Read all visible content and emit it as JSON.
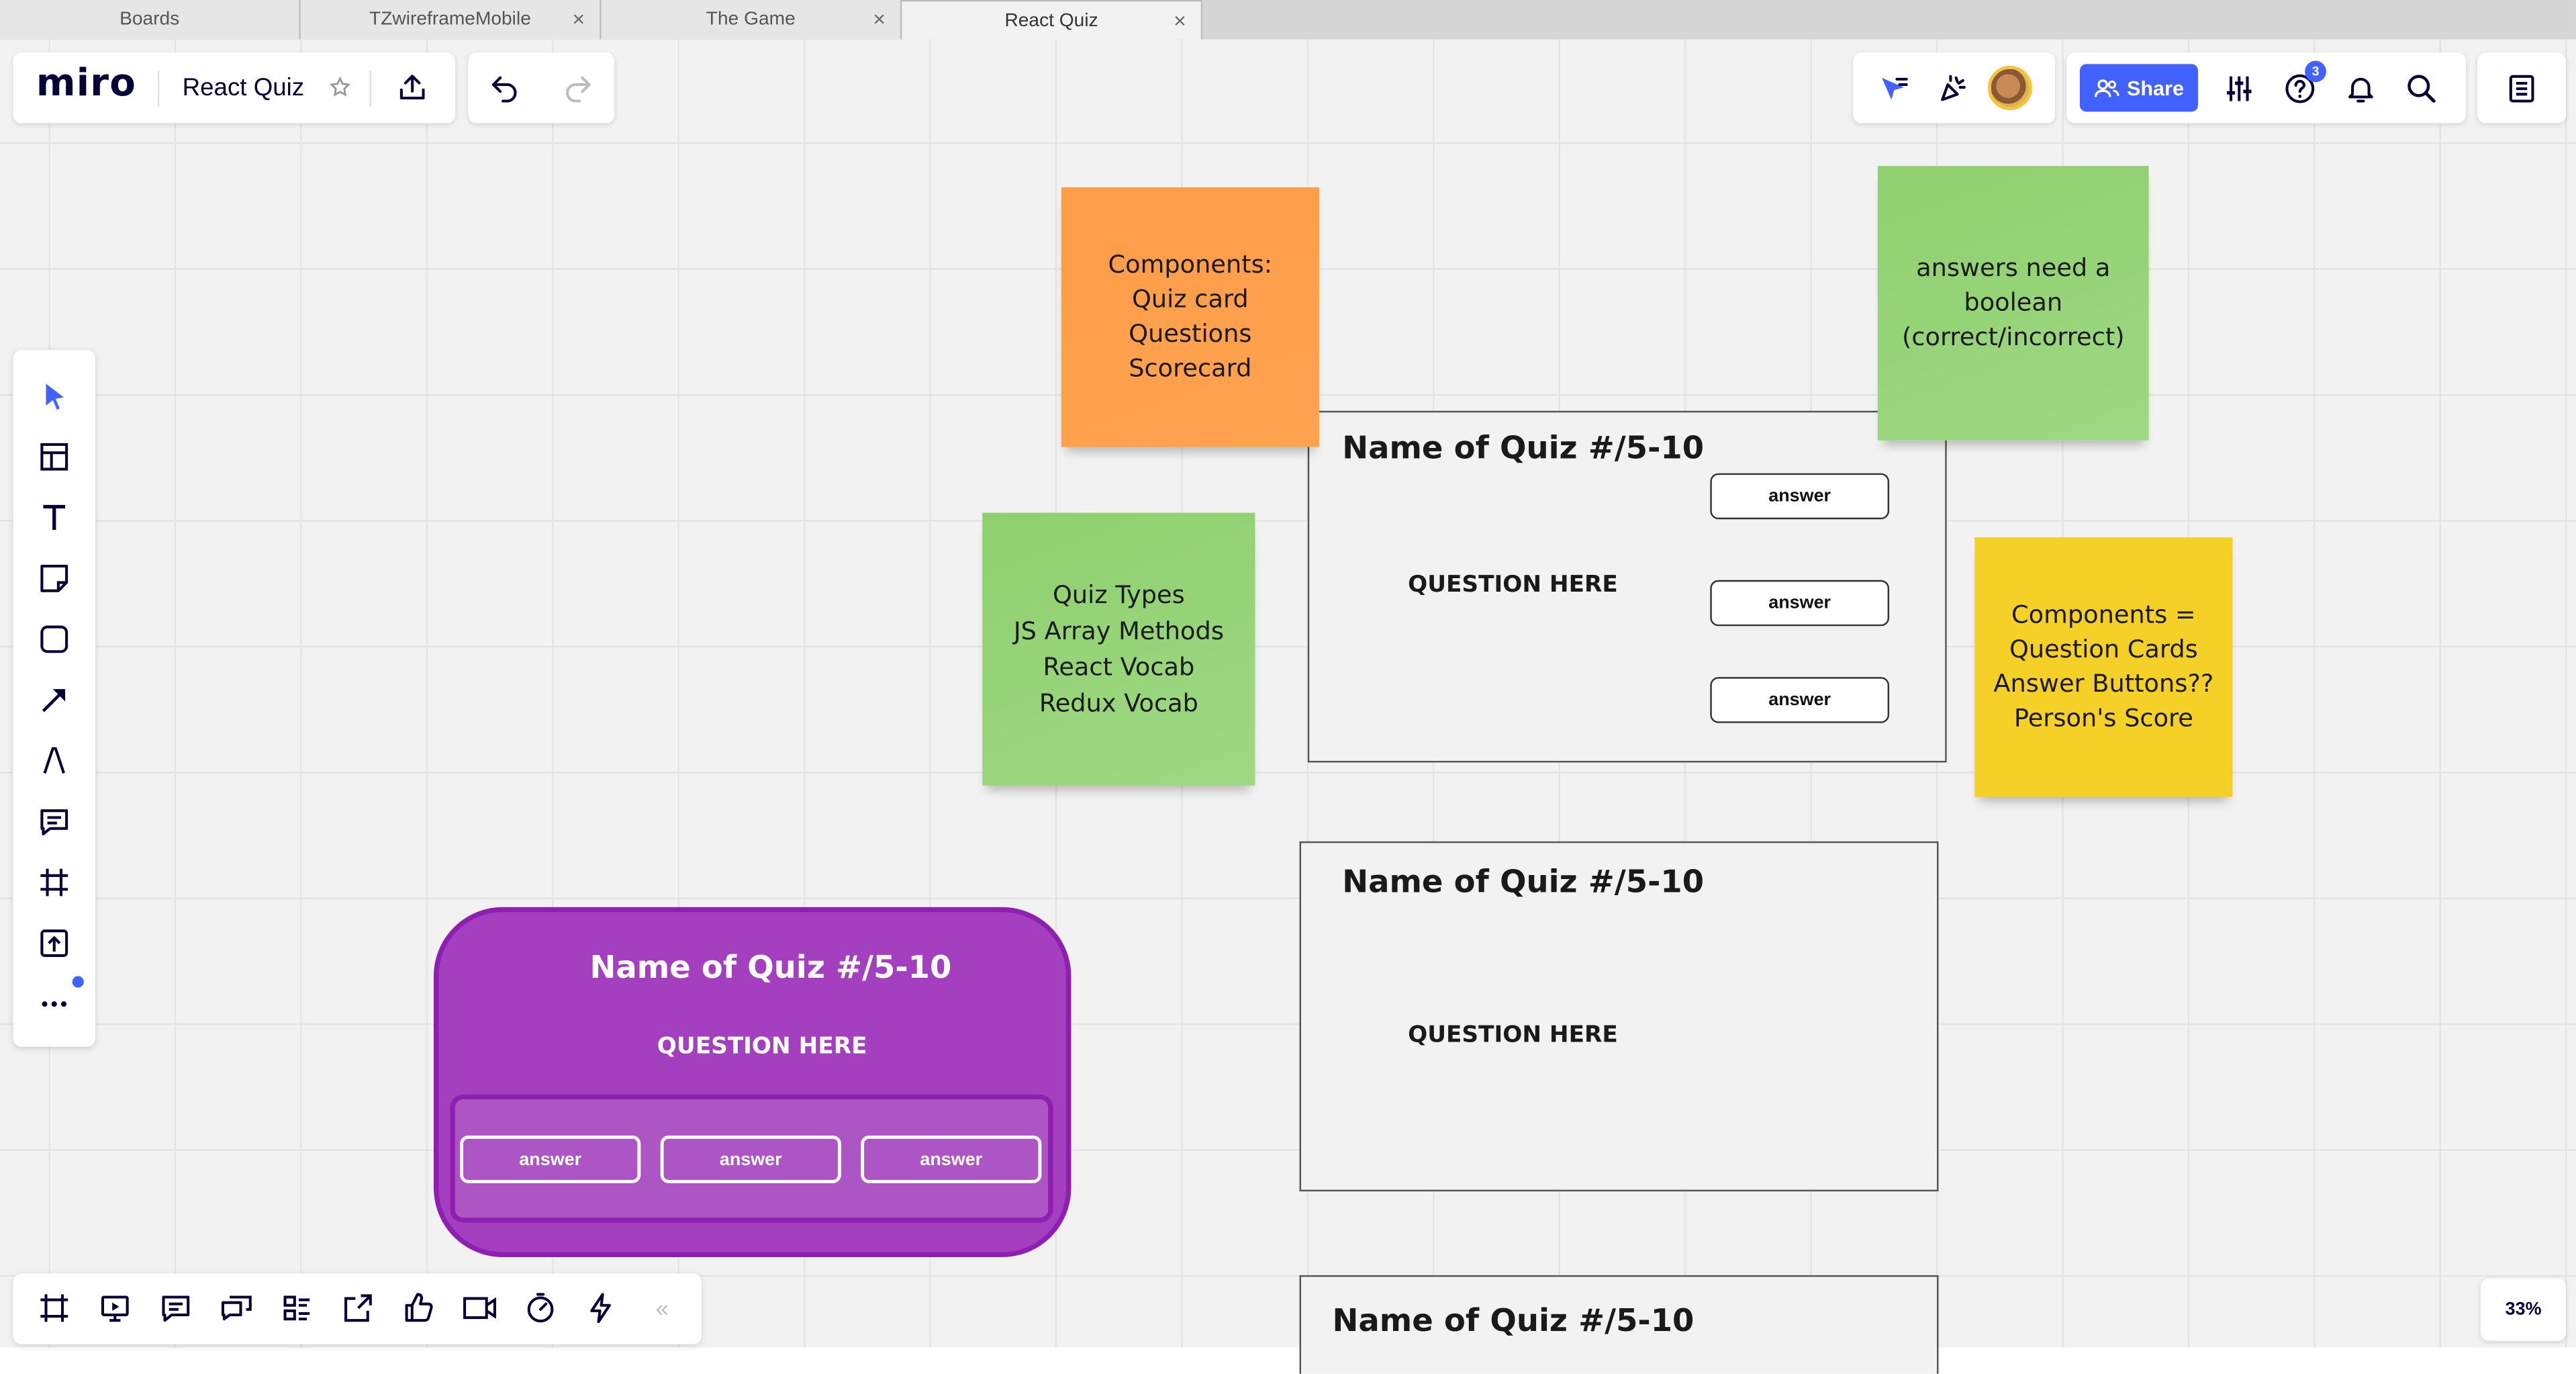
{
  "browser": {
    "tabs": [
      {
        "label": "Boards",
        "closable": false,
        "active": false
      },
      {
        "label": "TZwireframeMobile",
        "closable": true,
        "active": false
      },
      {
        "label": "The Game",
        "closable": true,
        "active": false
      },
      {
        "label": "React Quiz",
        "closable": true,
        "active": true
      }
    ],
    "close_glyph": "×"
  },
  "header": {
    "logo": "miro",
    "board_title": "React Quiz",
    "share_label": "Share",
    "help_badge": "3"
  },
  "zoom_level": "33%",
  "colors": {
    "accent": "#4262ff",
    "sticky_orange": "#ff9d48",
    "sticky_green": "#93d275",
    "sticky_yellow": "#f5d128",
    "purple_card": "#a43fbf"
  },
  "stickies": {
    "components": "Components:\nQuiz card\nQuestions\nScorecard",
    "quiz_types": "Quiz Types\nJS Array Methods\nReact Vocab\nRedux Vocab",
    "answers_boolean": "answers need a\nboolean\n(correct/incorrect)",
    "components_eq": "Components =\nQuestion Cards\nAnswer Buttons??\nPerson's Score"
  },
  "cards": {
    "card1": {
      "title": "Name of Quiz #/5-10",
      "question": "QUESTION HERE",
      "answers": [
        "answer",
        "answer",
        "answer"
      ]
    },
    "card2": {
      "title": "Name of Quiz #/5-10",
      "question": "QUESTION HERE"
    },
    "card3": {
      "title": "Name of Quiz #/5-10"
    },
    "purple": {
      "title": "Name of Quiz #/5-10",
      "question": "QUESTION HERE",
      "answers": [
        "answer",
        "answer",
        "answer"
      ]
    }
  },
  "left_toolbar_icons": [
    "select-icon",
    "templates-icon",
    "text-icon",
    "sticky-note-icon",
    "shape-icon",
    "arrow-icon",
    "pen-icon",
    "comment-icon",
    "frame-icon",
    "upload-icon",
    "more-icon"
  ],
  "bottom_toolbar_icons": [
    "frames-icon",
    "presentation-icon",
    "comments-icon",
    "chat-icon",
    "cards-icon",
    "share-screen-icon",
    "voting-icon",
    "video-icon",
    "timer-icon",
    "activity-icon",
    "collapse-icon"
  ],
  "collapse_glyph": "«"
}
